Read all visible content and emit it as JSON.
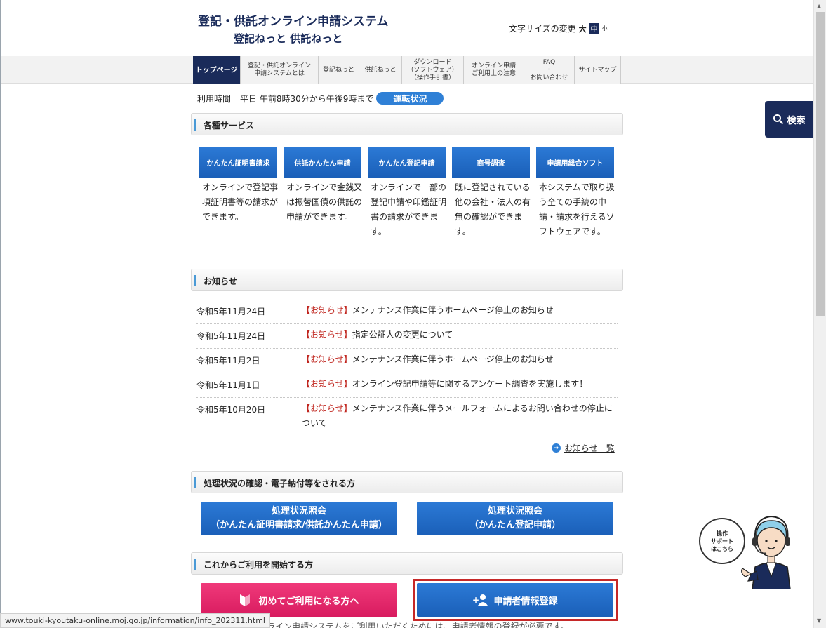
{
  "header": {
    "title": "登記・供託オンライン申請システム",
    "subtitle": "登記ねっと 供託ねっと",
    "font_size_label": "文字サイズの変更",
    "font_size_options": [
      "大",
      "中",
      "小"
    ]
  },
  "nav": {
    "items": [
      {
        "label": "トップページ",
        "active": true
      },
      {
        "label": "登記・供託オンライン\n申請システムとは"
      },
      {
        "label": "登記ねっと"
      },
      {
        "label": "供託ねっと"
      },
      {
        "label": "ダウンロード\n（ソフトウェア）\n（操作手引書）"
      },
      {
        "label": "オンライン申請\nご利用上の注意"
      },
      {
        "label": "FAQ\n・\nお問い合わせ"
      },
      {
        "label": "サイトマップ"
      }
    ]
  },
  "hours": {
    "label": "利用時間",
    "value": "平日 午前8時30分から午後9時まで",
    "status_button": "運転状況"
  },
  "search_button": "検索",
  "services": {
    "heading": "各種サービス",
    "items": [
      {
        "button": "かんたん証明書請求",
        "desc": "オンラインで登記事項証明書等の請求ができます。"
      },
      {
        "button": "供託かんたん申請",
        "desc": "オンラインで金銭又は振替国債の供託の申請ができます。"
      },
      {
        "button": "かんたん登記申請",
        "desc": "オンラインで一部の登記申請や印鑑証明書の請求ができます。"
      },
      {
        "button": "商号調査",
        "desc": "既に登記されている他の会社・法人の有無の確認ができます。"
      },
      {
        "button": "申請用総合ソフト",
        "desc": "本システムで取り扱う全ての手続の申請・請求を行えるソフトウェアです。"
      }
    ]
  },
  "news": {
    "heading": "お知らせ",
    "items": [
      {
        "date": "令和5年11月24日",
        "tag": "【お知らせ】",
        "title": "メンテナンス作業に伴うホームページ停止のお知らせ"
      },
      {
        "date": "令和5年11月24日",
        "tag": "【お知らせ】",
        "title": "指定公証人の変更について"
      },
      {
        "date": "令和5年11月2日",
        "tag": "【お知らせ】",
        "title": "メンテナンス作業に伴うホームページ停止のお知らせ"
      },
      {
        "date": "令和5年11月1日",
        "tag": "【お知らせ】",
        "title": "オンライン登記申請等に関するアンケート調査を実施します！"
      },
      {
        "date": "令和5年10月20日",
        "tag": "【お知らせ】",
        "title": "メンテナンス作業に伴うメールフォームによるお問い合わせの停止について"
      }
    ],
    "more_link": "お知らせ一覧"
  },
  "processing": {
    "heading": "処理状況の確認・電子納付等をされる方",
    "buttons": [
      {
        "line1": "処理状況照会",
        "line2": "（かんたん証明書請求/供託かんたん申請）"
      },
      {
        "line1": "処理状況照会",
        "line2": "（かんたん登記申請）"
      }
    ]
  },
  "start": {
    "heading": "これからご利用を開始する方",
    "first_time_button": "初めてご利用になる方へ",
    "register_button": "申請者情報登録",
    "cutoff_text": "ライン申請システムをご利用いただくためには、申請者情報の登録が必要です。"
  },
  "support": {
    "bubble_lines": [
      "操作",
      "サポート",
      "はこちら"
    ]
  },
  "status_bar_url": "www.touki-kyoutaku-online.moj.go.jp/information/info_202311.html",
  "colors": {
    "brand_navy": "#1a2b5a",
    "button_blue": "#1a5fb8",
    "pink": "#d81b5f",
    "highlight_red": "#c62828",
    "news_tag_red": "#c0261f"
  }
}
